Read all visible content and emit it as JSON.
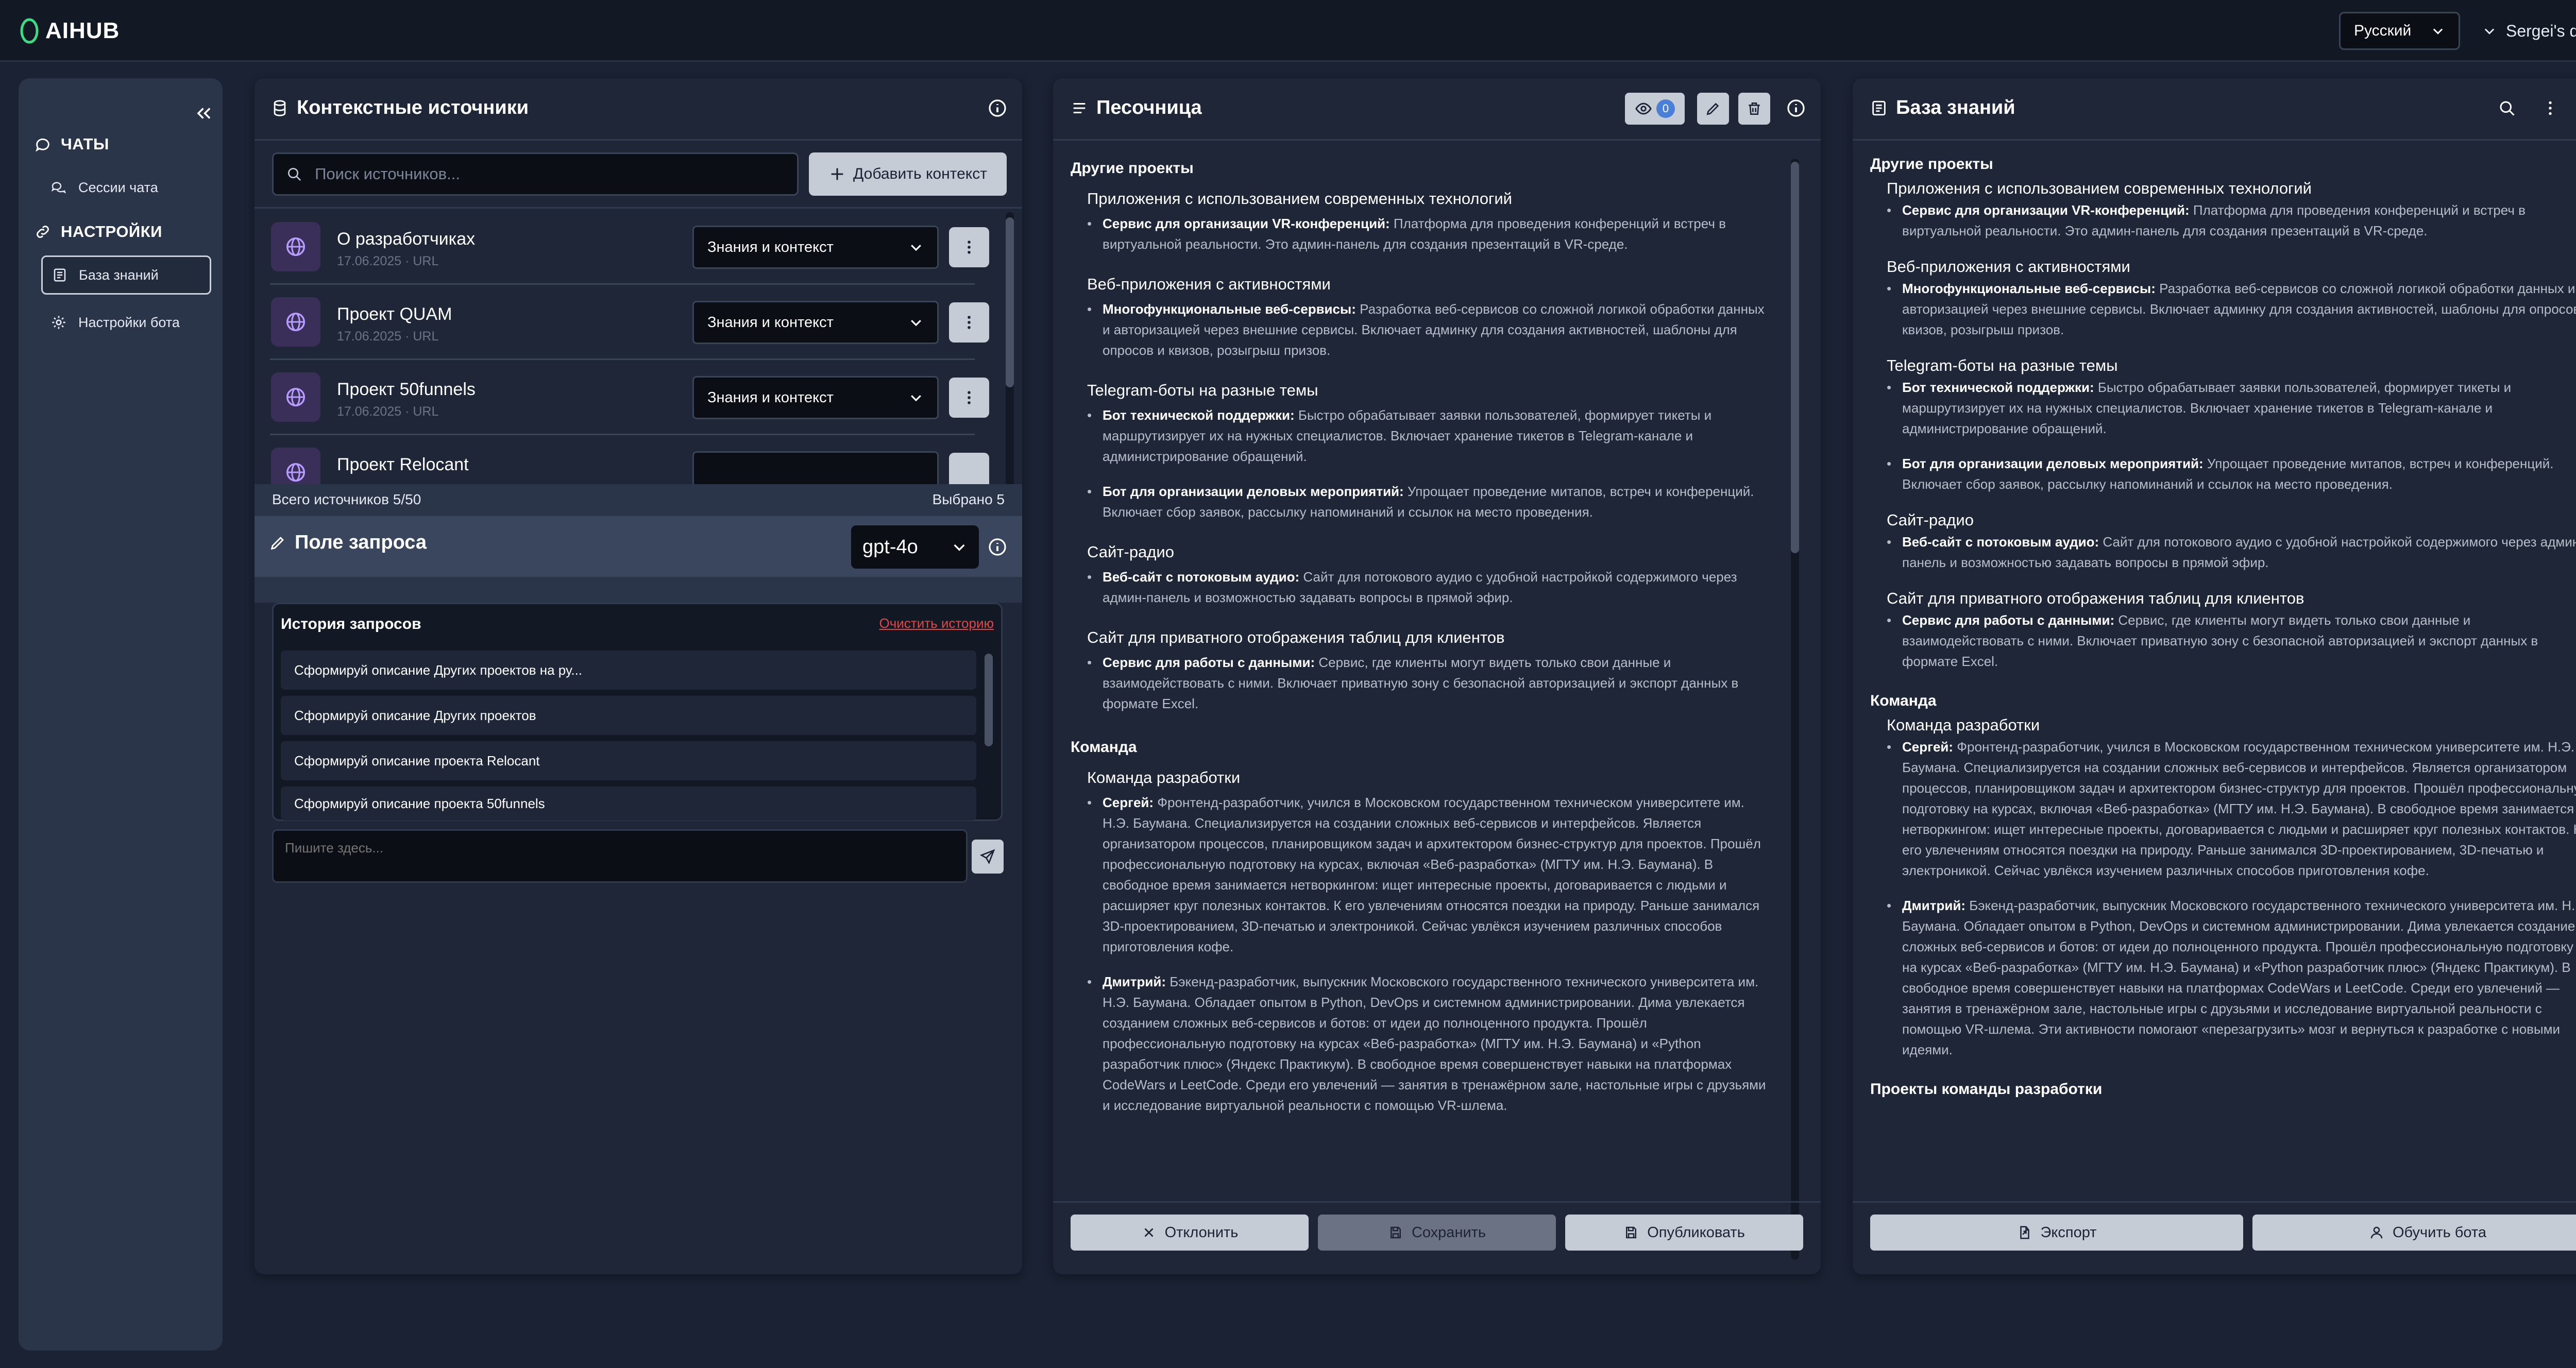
{
  "app": {
    "logo": "AIHUB"
  },
  "header": {
    "language": "Русский",
    "user": "Sergei's demo"
  },
  "sidebar": {
    "sections": [
      {
        "label": "ЧАТЫ",
        "items": [
          {
            "label": "Сессии чата"
          }
        ]
      },
      {
        "label": "НАСТРОЙКИ",
        "items": [
          {
            "label": "База знаний"
          },
          {
            "label": "Настройки бота"
          }
        ]
      }
    ]
  },
  "sources": {
    "title": "Контекстные источники",
    "search_placeholder": "Поиск источников...",
    "add_label": "Добавить контекст",
    "items": [
      {
        "name": "О разработчиках",
        "meta": "17.06.2025 · URL",
        "mode": "Знания и контекст"
      },
      {
        "name": "Проект QUAM",
        "meta": "17.06.2025 · URL",
        "mode": "Знания и контекст"
      },
      {
        "name": "Проект 50funnels",
        "meta": "17.06.2025 · URL",
        "mode": "Знания и контекст"
      },
      {
        "name": "Проект Relocant",
        "meta": "",
        "mode": ""
      }
    ],
    "total": "Всего источников 5/50",
    "selected": "Выбрано 5"
  },
  "query": {
    "title": "Поле запроса",
    "model": "gpt-4o",
    "history_title": "История запросов",
    "clear_label": "Очистить историю",
    "history": [
      "Сформируй описание Других проектов на ру...",
      "Сформируй описание Других проектов",
      "Сформируй описание проекта Relocant",
      "Сформируй описание проекта 50funnels"
    ],
    "input_placeholder": "Пишите здесь..."
  },
  "sandbox": {
    "title": "Песочница",
    "view_count": "0",
    "sec1": "Другие проекты",
    "p1_title": "Приложения с использованием современных технологий",
    "p1_b": "Сервис для организации VR-конференций:",
    "p1_t": " Платформа для проведения конференций и встреч в виртуальной реальности. Это админ-панель для создания презентаций в VR-среде.",
    "p2_title": "Веб-приложения с активностями",
    "p2_b": "Многофункциональные веб-сервисы:",
    "p2_t": " Разработка веб-сервисов со сложной логикой обработки данных и авторизацией через внешние сервисы. Включает админку для создания активностей, шаблоны для опросов и квизов, розыгрыш призов.",
    "p3_title": "Telegram-боты на разные темы",
    "p3a_b": "Бот технической поддержки:",
    "p3a_t": " Быстро обрабатывает заявки пользователей, формирует тикеты и маршрутизирует их на нужных специалистов. Включает хранение тикетов в Telegram-канале и администрирование обращений.",
    "p3b_b": "Бот для организации деловых мероприятий:",
    "p3b_t": " Упрощает проведение митапов, встреч и конференций. Включает сбор заявок, рассылку напоминаний и ссылок на место проведения.",
    "p4_title": "Сайт-радио",
    "p4_b": "Веб-сайт с потоковым аудио:",
    "p4_t": " Сайт для потокового аудио с удобной настройкой содержимого через админ-панель и возможностью задавать вопросы в прямой эфир.",
    "p5_title": "Сайт для приватного отображения таблиц для клиентов",
    "p5_b": "Сервис для работы с данными:",
    "p5_t": " Сервис, где клиенты могут видеть только свои данные и взаимодействовать с ними. Включает приватную зону с безопасной авторизацией и экспорт данных в формате Excel.",
    "sec2": "Команда",
    "t_title": "Команда разработки",
    "t1_b": "Сергей:",
    "t1_t": " Фронтенд-разработчик, учился в Московском государственном техническом университете им. Н.Э. Баумана. Специализируется на создании сложных веб-сервисов и интерфейсов. Является организатором процессов, планировщиком задач и архитектором бизнес-структур для проектов. Прошёл профессиональную подготовку на курсах, включая «Веб-разработка» (МГТУ им. Н.Э. Баумана). В свободное время занимается нетворкингом: ищет интересные проекты, договаривается с людьми и расширяет круг полезных контактов. К его увлечениям относятся поездки на природу. Раньше занимался 3D-проектированием, 3D-печатью и электроникой. Сейчас увлёкся изучением различных способов приготовления кофе.",
    "t2_b": "Дмитрий:",
    "t2_t": " Бэкенд-разработчик, выпускник Московского государственного технического университета им. Н.Э. Баумана. Обладает опытом в Python, DevOps и системном администрировании. Дима увлекается созданием сложных веб-сервисов и ботов: от идеи до полноценного продукта. Прошёл профессиональную подготовку на курсах «Веб-разработка» (МГТУ им. Н.Э. Баумана) и «Python разработчик плюс» (Яндекс Практикум). В свободное время совершенствует навыки на платформах CodeWars и LeetCode. Среди его увлечений — занятия в тренажёрном зале, настольные игры с друзьями и исследование виртуальной реальности с помощью VR-шлема.",
    "reject_label": "Отклонить",
    "save_label": "Сохранить",
    "publish_label": "Опубликовать"
  },
  "kb": {
    "title": "База знаний",
    "sec3": "Проекты команды разработки",
    "t2_tail": " Эти активности помогают «перезагрузить» мозг и вернуться к разработке с новыми идеями.",
    "export_label": "Экспорт",
    "train_label": "Обучить бота"
  }
}
